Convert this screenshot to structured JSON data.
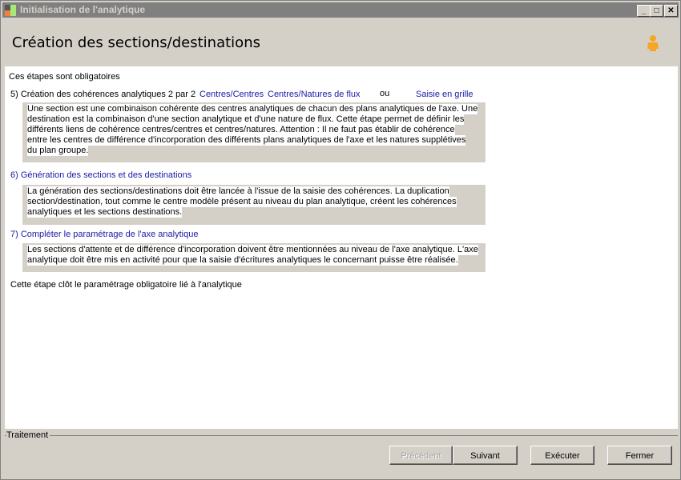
{
  "window": {
    "title": "Initialisation de l'analytique",
    "minimize": "_",
    "maximize": "□",
    "close": "✕"
  },
  "header": {
    "title": "Création des sections/destinations",
    "icon": "user-icon"
  },
  "content": {
    "intro": "Ces étapes sont obligatoires",
    "step5": {
      "label": "5) Création des cohérences analytiques 2 par 2",
      "link1": "Centres/Centres",
      "link2": "Centres/Natures de flux",
      "or": "ou",
      "link3": "Saisie en grille",
      "lines": [
        "Une section est une combinaison cohérente des centres analytiques de chacun des plans analytiques de l'axe. Une",
        "destination est la combinaison d'une section analytique et d'une nature de flux. Cette étape permet de définir les",
        "différents liens de cohérence centres/centres et centres/natures. Attention : Il ne faut pas établir de cohérence",
        "entre les centres de différence d'incorporation des différents plans analytiques de l'axe et les natures supplétives",
        "du plan groupe."
      ]
    },
    "step6": {
      "label": "6) Génération des sections et des destinations",
      "lines": [
        "La génération des sections/destinations doit être lancée à l'issue de la saisie des cohérences. La duplication",
        "section/destination, tout comme le centre modèle présent au niveau du plan analytique, créent les cohérences",
        "analytiques et les sections destinations."
      ]
    },
    "step7": {
      "label": "7) Compléter le paramétrage de l'axe analytique",
      "lines": [
        "Les sections d'attente et de différence d'incorporation doivent être mentionnées au niveau de l'axe analytique. L'axe",
        "analytique doit être mis en activité pour que la saisie d'écritures analytiques le concernant puisse être réalisée."
      ]
    },
    "footer": "Cette étape clôt le paramétrage obligatoire lié à l'analytique"
  },
  "treatment": {
    "label": "Traitement",
    "previous": "Précédent",
    "next": "Suivant",
    "execute": "Exécuter",
    "close": "Fermer"
  }
}
